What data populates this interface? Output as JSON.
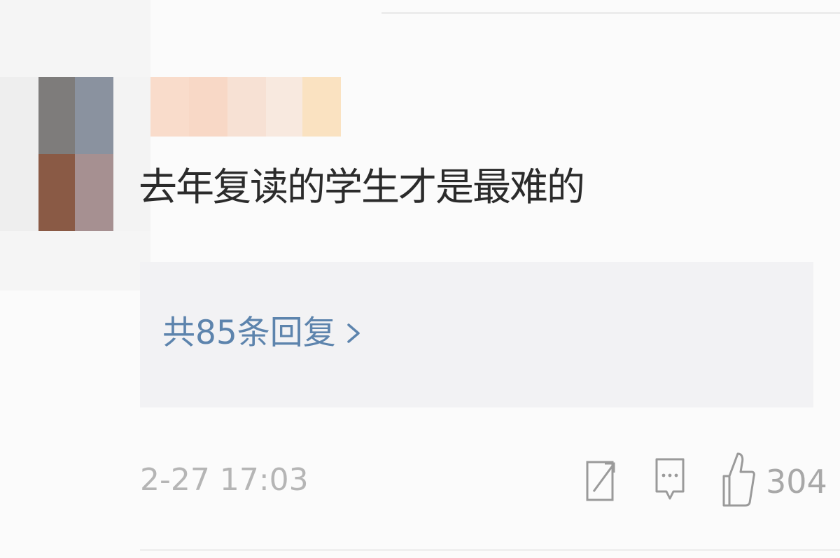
{
  "comment": {
    "text": "去年复读的学生才是最难的"
  },
  "replies": {
    "link_label": "共85条回复",
    "chevron_icon": "chevron-right-icon"
  },
  "footer": {
    "timestamp": "2-27 17:03",
    "actions": {
      "repost_icon": "repost-icon",
      "comment_icon": "comment-icon",
      "like_icon": "thumbs-up-icon",
      "like_count": "304"
    }
  },
  "colors": {
    "background": "#fbfbfb",
    "reply_box": "#f2f2f4",
    "link": "#5d84ad",
    "body_text": "#2b2b2b",
    "muted": "#b5b5b5"
  }
}
